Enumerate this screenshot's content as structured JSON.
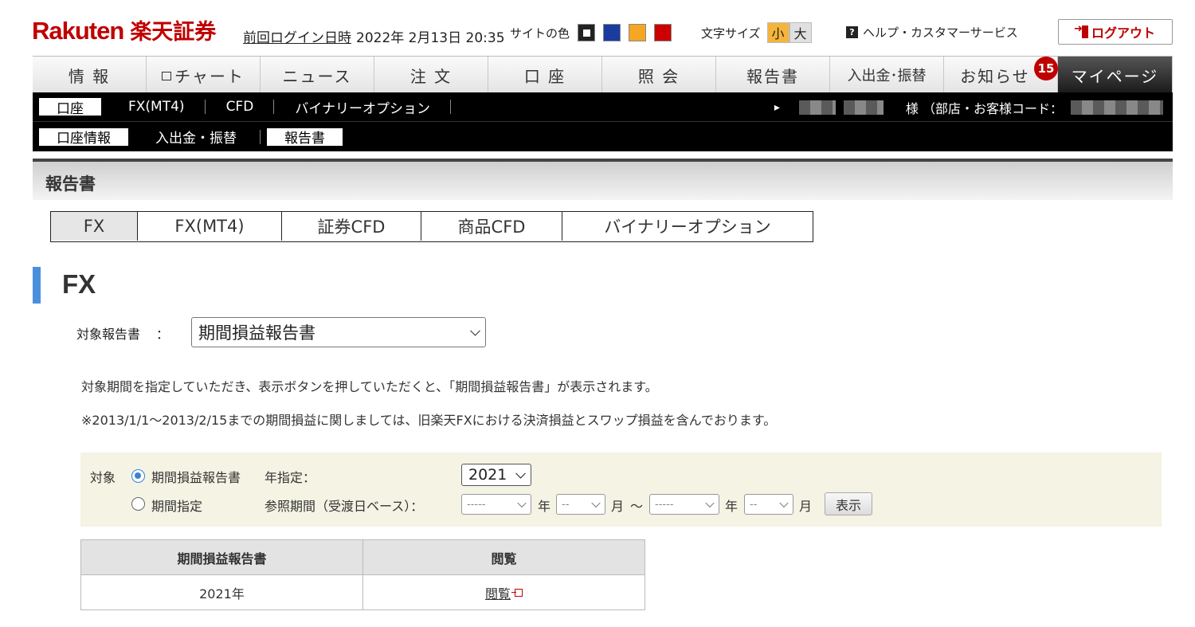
{
  "header": {
    "logo_text": "Rakuten",
    "logo_jp": "楽天証券",
    "last_login_label": "前回ログイン日時",
    "last_login_value": "2022年 2月13日 20:35",
    "site_color_label": "サイトの色",
    "site_colors": [
      "#222222",
      "#1a3c9c",
      "#f5a623",
      "#cc0000"
    ],
    "font_size_label": "文字サイズ",
    "font_small": "小",
    "font_large": "大",
    "help_label": "ヘルプ・カスタマーサービス",
    "help_icon": "?",
    "logout_label": "ログアウト"
  },
  "main_nav": {
    "tabs": [
      {
        "label": "情 報"
      },
      {
        "label": "チャート"
      },
      {
        "label": "ニュース"
      },
      {
        "label": "注 文"
      },
      {
        "label": "口 座"
      },
      {
        "label": "照 会"
      },
      {
        "label": "報告書"
      },
      {
        "label": "入出金･振替"
      },
      {
        "label": "お知らせ"
      },
      {
        "label": "マイページ"
      }
    ],
    "notice_badge": "15"
  },
  "sub_nav": {
    "items": [
      "口座",
      "FX(MT4)",
      "CFD",
      "バイナリーオプション"
    ],
    "account_arrow": "▸",
    "account_suffix": "様 （部店・お客様コード："
  },
  "sub_nav2": {
    "items": [
      "口座情報",
      "入出金・振替",
      "報告書"
    ]
  },
  "page": {
    "title": "報告書",
    "product_tabs": [
      "FX",
      "FX(MT4)",
      "証券CFD",
      "商品CFD",
      "バイナリーオプション"
    ],
    "section_title": "FX",
    "report_label": "対象報告書",
    "report_colon": "：",
    "report_selected": "期間損益報告書",
    "desc1": "対象期間を指定していただき、表示ボタンを押していただくと、「期間損益報告書」が表示されます。",
    "desc2": "※2013/1/1〜2013/2/15までの期間損益に関しましては、旧楽天FXにおける決済損益とスワップ損益を含んでおります。"
  },
  "filter": {
    "target_label": "対象",
    "option_report": "期間損益報告書",
    "option_period": "期間指定",
    "year_label": "年指定：",
    "year_value": "2021",
    "period_label": "参照期間（受渡日ベース）：",
    "from_year": "-----",
    "from_month": "--",
    "to_year": "-----",
    "to_month": "--",
    "year_unit": "年",
    "month_unit": "月",
    "tilde": "〜",
    "show_button": "表示"
  },
  "result_table": {
    "headers": [
      "期間損益報告書",
      "閲覧"
    ],
    "rows": [
      {
        "period": "2021年",
        "view": "閲覧"
      }
    ]
  }
}
